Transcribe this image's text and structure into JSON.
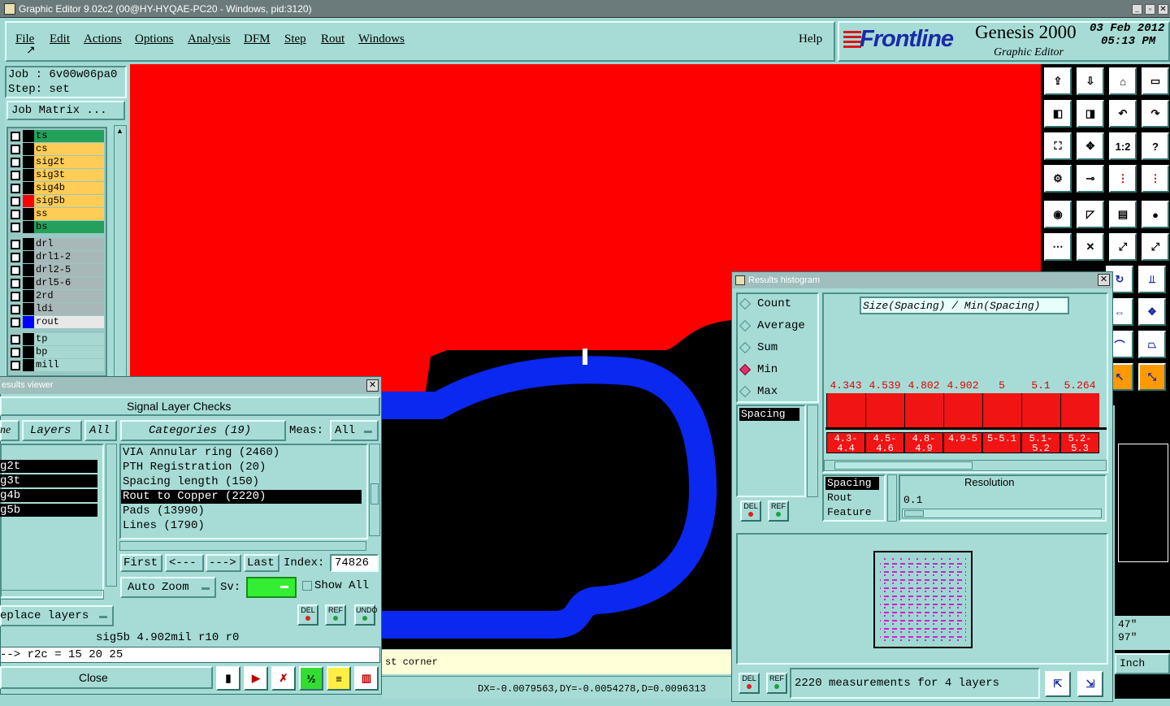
{
  "window": {
    "title": "Graphic Editor 9.02c2 (00@HY-HYQAE-PC20 - Windows, pid:3120)"
  },
  "menu": [
    "File",
    "Edit",
    "Actions",
    "Options",
    "Analysis",
    "DFM",
    "Step",
    "Rout",
    "Windows"
  ],
  "help": "Help",
  "brand": {
    "logo": "Frontline",
    "product": "Genesis 2000",
    "subtitle": "Graphic Editor",
    "date": "03 Feb 2012",
    "time": "05:13 PM"
  },
  "job": {
    "job": "Job : 6v00w06pa0",
    "step": "Step: set",
    "matrix_button": "Job Matrix ..."
  },
  "layers": [
    {
      "name": "ts",
      "color": "#23a05a",
      "swatch": "#000000"
    },
    {
      "name": "cs",
      "color": "#ffcc55",
      "swatch": "#000000"
    },
    {
      "name": "sig2t",
      "color": "#ffcc55",
      "swatch": "#000000"
    },
    {
      "name": "sig3t",
      "color": "#ffcc55",
      "swatch": "#000000"
    },
    {
      "name": "sig4b",
      "color": "#ffcc55",
      "swatch": "#000000"
    },
    {
      "name": "sig5b",
      "color": "#ffcc55",
      "swatch": "#ff0000"
    },
    {
      "name": "ss",
      "color": "#ffcc55",
      "swatch": "#000000"
    },
    {
      "name": "bs",
      "color": "#23a05a",
      "swatch": "#000000"
    },
    {
      "name": "drl",
      "color": "#a8b8b8",
      "swatch": "#000000"
    },
    {
      "name": "drl1-2",
      "color": "#a8b8b8",
      "swatch": "#000000"
    },
    {
      "name": "drl2-5",
      "color": "#a8b8b8",
      "swatch": "#000000"
    },
    {
      "name": "drl5-6",
      "color": "#a8b8b8",
      "swatch": "#000000"
    },
    {
      "name": "2rd",
      "color": "#a8b8b8",
      "swatch": "#000000"
    },
    {
      "name": "ldi",
      "color": "#a8b8b8",
      "swatch": "#000000"
    },
    {
      "name": "rout",
      "color": "#e8e8e8",
      "swatch": "#0000ff"
    },
    {
      "name": "tp",
      "color": "#a8d8d2",
      "swatch": "#000000"
    },
    {
      "name": "bp",
      "color": "#a8d8d2",
      "swatch": "#000000"
    },
    {
      "name": "mill",
      "color": "#a8d8d2",
      "swatch": "#000000"
    }
  ],
  "results_viewer": {
    "title": "esults viewer",
    "header": "Signal Layer Checks",
    "tab_partial": "ne",
    "tab_layers": "Layers",
    "tab_all": "All",
    "categories_label": "Categories (19)",
    "meas_label": "Meas:",
    "meas_value": "All",
    "layer_list": [
      "g2t",
      "g3t",
      "g4b",
      "g5b"
    ],
    "categories": [
      "VIA Annular ring (2460)",
      "PTH Registration (20)",
      "Spacing length (150)",
      "Rout to Copper (2220)",
      "Pads (13990)",
      "Lines (1790)"
    ],
    "selected_category": 3,
    "nav": {
      "first": "First",
      "prev": "<---",
      "next": "--->",
      "last": "Last",
      "index_label": "Index:",
      "index_value": "74826"
    },
    "auto_zoom": "Auto Zoom",
    "sv_label": "Sv:",
    "show_all": "Show All",
    "replace_layers": "eplace layers",
    "small_buttons": [
      "DEL",
      "REF",
      "UNDO"
    ],
    "status": "sig5b 4.902mil  r10  r0",
    "cmd": "--> r2c = 15 20 25",
    "close": "Close"
  },
  "histogram": {
    "title": "Results histogram",
    "modes": [
      "Count",
      "Average",
      "Sum",
      "Min",
      "Max"
    ],
    "selected_mode": "Min",
    "list_item": "Spacing",
    "chart_label": "Size(Spacing) / Min(Spacing)",
    "bars": [
      "4.343",
      "4.539",
      "4.802",
      "4.902",
      "5",
      "5.1",
      "5.264"
    ],
    "bins": [
      "4.3-4.4",
      "4.5-4.6",
      "4.8-4.9",
      "4.9-5",
      "5-5.1",
      "5.1-5.2",
      "5.2-5.3"
    ],
    "fields": [
      "Spacing",
      "Rout",
      "Feature"
    ],
    "resolution_label": "Resolution",
    "resolution_value": "0.1",
    "summary": "2220 measurements for 4 layers",
    "small_buttons": [
      "DEL",
      "REF"
    ]
  },
  "canvas": {
    "status_partial": "st corner",
    "coords": "DX=-0.0079563,DY=-0.0054278,D=0.0096313"
  },
  "right_panel": {
    "unit": "Inch",
    "readout1": "47\"",
    "readout2": "97\""
  },
  "toolbar_icons": [
    "open-icon",
    "save-icon",
    "home-icon",
    "window-icon",
    "left-icon",
    "right-icon",
    "undo-icon",
    "redo-icon",
    "fit-icon",
    "zoom-icon",
    "scale-icon",
    "help-icon",
    "tools-icon",
    "probe-icon",
    "red-line-icon",
    "red-grid-icon",
    "circle-icon",
    "draw-icon",
    "ruler-icon",
    "dot-icon",
    "net-icon",
    "cross-icon",
    "snap-icon",
    "snap2-icon"
  ],
  "toolbar_labels": [
    "",
    "",
    "",
    "",
    "",
    "",
    "",
    "",
    "",
    "",
    "1:2",
    "?",
    "",
    "",
    "",
    "",
    "",
    "",
    "",
    "",
    "",
    "",
    "",
    ""
  ],
  "colors": {
    "canvas_bg": "#ff0000",
    "copper": "#000000",
    "rout": "#0a28f0",
    "panel": "#a7dcd6"
  }
}
